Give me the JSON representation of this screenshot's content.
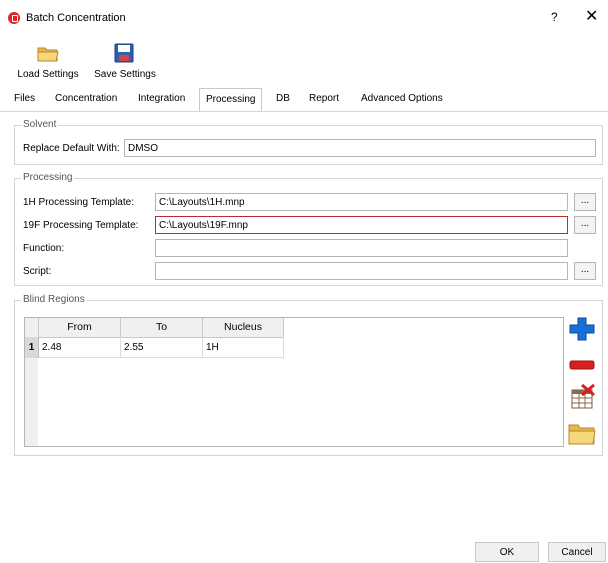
{
  "window": {
    "title": "Batch Concentration",
    "help": "?",
    "close": "✕"
  },
  "toolbar": {
    "load_label": "Load Settings",
    "save_label": "Save Settings"
  },
  "tabs": [
    {
      "label": "Files"
    },
    {
      "label": "Concentration"
    },
    {
      "label": "Integration"
    },
    {
      "label": "Processing",
      "active": true
    },
    {
      "label": "DB"
    },
    {
      "label": "Report"
    },
    {
      "label": "Advanced Options"
    }
  ],
  "solvent": {
    "group_title": "Solvent",
    "replace_label": "Replace Default With:",
    "replace_value": "DMSO"
  },
  "processing": {
    "group_title": "Processing",
    "h1_label": "1H Processing Template:",
    "h1_value": "C:\\Layouts\\1H.mnp",
    "f19_label": "19F Processing Template:",
    "f19_value": "C:\\Layouts\\19F.mnp",
    "function_label": "Function:",
    "function_value": "",
    "script_label": "Script:",
    "script_value": "",
    "browse": "..."
  },
  "blind_regions": {
    "group_title": "Blind Regions",
    "columns": [
      "From",
      "To",
      "Nucleus"
    ],
    "rows": [
      {
        "index": "1",
        "from": "2.48",
        "to": "2.55",
        "nucleus": "1H"
      }
    ]
  },
  "buttons": {
    "ok": "OK",
    "cancel": "Cancel"
  },
  "colors": {
    "accent_red": "#c0282e",
    "add_blue": "#1a6fd6",
    "remove_red": "#d81e1e",
    "folder_yellow": "#f2c94c"
  }
}
